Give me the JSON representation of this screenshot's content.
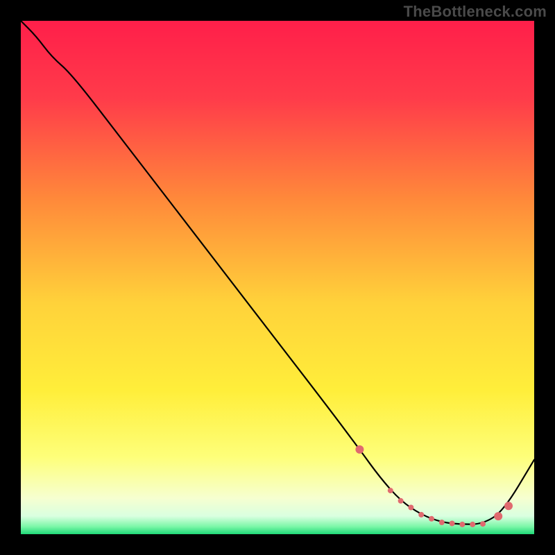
{
  "watermark": "TheBottleneck.com",
  "chart_data": {
    "type": "line",
    "title": "",
    "xlabel": "",
    "ylabel": "",
    "xlim": [
      0,
      100
    ],
    "ylim": [
      0,
      100
    ],
    "gradient_stops": [
      {
        "offset": 0.0,
        "color": "#ff1f4a"
      },
      {
        "offset": 0.15,
        "color": "#ff3b4a"
      },
      {
        "offset": 0.35,
        "color": "#ff8a3a"
      },
      {
        "offset": 0.55,
        "color": "#ffd23a"
      },
      {
        "offset": 0.72,
        "color": "#ffee3a"
      },
      {
        "offset": 0.85,
        "color": "#feff7a"
      },
      {
        "offset": 0.93,
        "color": "#f6ffd0"
      },
      {
        "offset": 0.965,
        "color": "#d9ffe0"
      },
      {
        "offset": 0.985,
        "color": "#7cf7a8"
      },
      {
        "offset": 1.0,
        "color": "#1fd978"
      }
    ],
    "series": [
      {
        "name": "bottleneck-curve",
        "color": "#000000",
        "x": [
          0,
          3,
          6,
          10,
          20,
          30,
          40,
          50,
          60,
          66,
          70,
          74,
          78,
          82,
          86,
          90,
          94,
          100
        ],
        "y": [
          100,
          97,
          93,
          89.5,
          76.5,
          63.5,
          50.5,
          37.5,
          24.5,
          16.5,
          11,
          6.5,
          3.8,
          2.3,
          1.9,
          2.0,
          4.5,
          14.5
        ]
      }
    ],
    "markers": {
      "name": "highlight-points",
      "color": "#e06a6f",
      "radius_small": 4,
      "radius_large": 6,
      "x": [
        66,
        72,
        74,
        76,
        78,
        80,
        82,
        84,
        86,
        88,
        90,
        93,
        95
      ],
      "y": [
        16.5,
        8.5,
        6.5,
        5.2,
        3.8,
        3.0,
        2.3,
        2.1,
        1.9,
        1.9,
        2.0,
        3.5,
        5.5
      ],
      "large_indices": [
        0,
        11,
        12
      ]
    }
  }
}
